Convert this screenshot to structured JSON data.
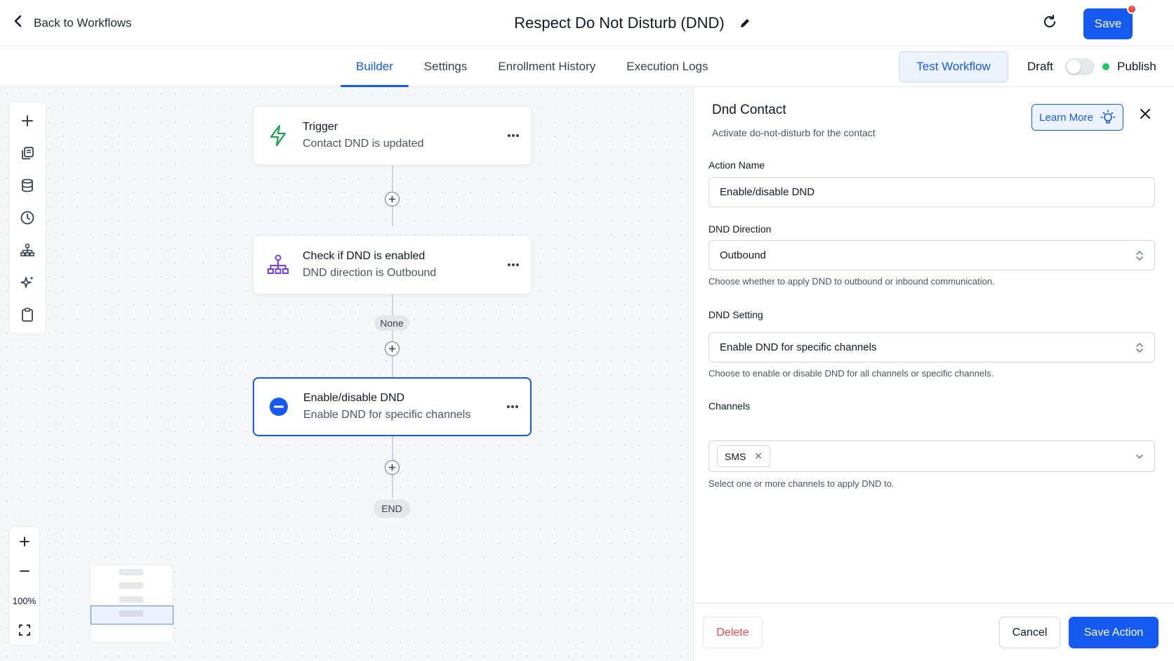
{
  "header": {
    "back_label": "Back to Workflows",
    "title": "Respect Do Not Disturb (DND)",
    "save_label": "Save",
    "save_badge": "!"
  },
  "tabs": [
    {
      "label": "Builder",
      "active": true
    },
    {
      "label": "Settings",
      "active": false
    },
    {
      "label": "Enrollment History",
      "active": false
    },
    {
      "label": "Execution Logs",
      "active": false
    }
  ],
  "toolbar_right": {
    "test_label": "Test Workflow",
    "draft_label": "Draft",
    "publish_label": "Publish",
    "publish_on": false
  },
  "canvas": {
    "tools": [
      "plus-icon",
      "copy-icon",
      "database-icon",
      "clock-icon",
      "hierarchy-icon",
      "sparkles-icon",
      "clipboard-icon"
    ],
    "nodes": [
      {
        "title": "Trigger",
        "subtitle": "Contact DND is updated",
        "icon": "lightning-icon"
      },
      {
        "title": "Check if DND is enabled",
        "subtitle": "DND direction is Outbound",
        "icon": "hierarchy-icon"
      },
      {
        "title": "Enable/disable DND",
        "subtitle": "Enable DND for specific channels",
        "icon": "minus-circle-icon"
      }
    ],
    "branch_label": "None",
    "end_label": "END",
    "zoom_level": "100%"
  },
  "panel": {
    "title": "Dnd Contact",
    "subtitle": "Activate do-not-disturb for the contact",
    "learn_more_label": "Learn More",
    "fields": {
      "action_name": {
        "label": "Action Name",
        "value": "Enable/disable DND"
      },
      "dnd_direction": {
        "label": "DND Direction",
        "value": "Outbound",
        "help": "Choose whether to apply DND to outbound or inbound communication."
      },
      "dnd_setting": {
        "label": "DND Setting",
        "value": "Enable DND for specific channels",
        "help": "Choose to enable or disable DND for all channels or specific channels."
      },
      "channels": {
        "label": "Channels",
        "values": [
          "SMS"
        ],
        "help": "Select one or more channels to apply DND to."
      }
    },
    "footer": {
      "delete_label": "Delete",
      "cancel_label": "Cancel",
      "save_action_label": "Save Action"
    }
  },
  "colors": {
    "accent": "#1459f0",
    "publish_dot": "#22c55e",
    "delete": "#ef4444",
    "trigger_icon": "#16a34a",
    "branch_icon": "#7c3aed"
  }
}
